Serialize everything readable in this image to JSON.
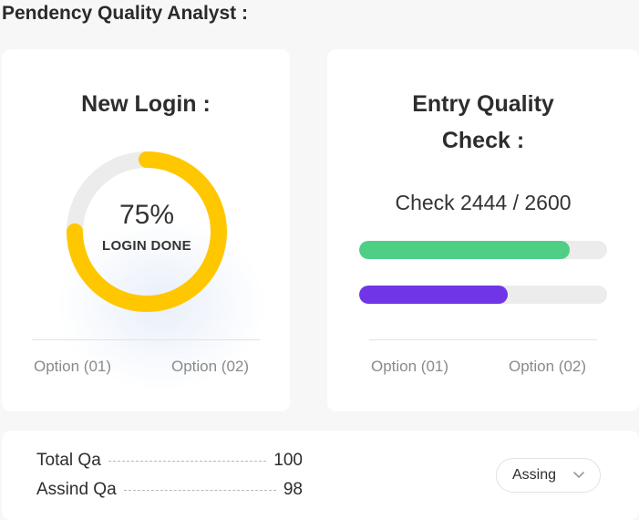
{
  "page": {
    "title": "Pendency Quality Analyst :"
  },
  "login_card": {
    "title": "New Login :",
    "percent_text": "75%",
    "percent": 75,
    "label": "LOGIN DONE",
    "option1": "Option (01)",
    "option2": "Option (02)",
    "colors": {
      "progress": "#ffc700",
      "track": "#ececec"
    }
  },
  "entry_card": {
    "title_line1": "Entry Quality",
    "title_line2": "Check :",
    "check_text": "Check 2444 / 2600",
    "bars": [
      {
        "fraction": 0.85,
        "color": "#4fcf86"
      },
      {
        "fraction": 0.6,
        "color": "#7135e8"
      }
    ],
    "option1": "Option (01)",
    "option2": "Option (02)"
  },
  "summary": {
    "rows": [
      {
        "label": "Total Qa",
        "value": "100"
      },
      {
        "label": "Assind Qa",
        "value": "98"
      }
    ],
    "select": {
      "value": "Assing",
      "icon": "chevron-down-icon"
    }
  }
}
